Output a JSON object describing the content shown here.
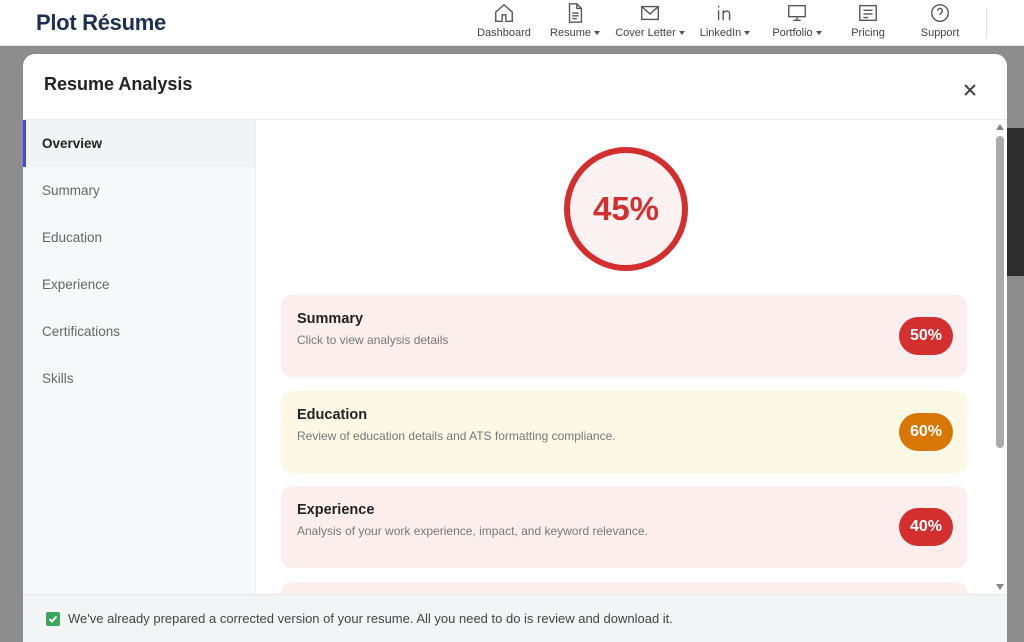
{
  "app": {
    "logo": "Plot Résume"
  },
  "nav": [
    {
      "label": "Dashboard",
      "icon": "home-icon",
      "dropdown": false
    },
    {
      "label": "Resume",
      "icon": "document-icon",
      "dropdown": true
    },
    {
      "label": "Cover Letter",
      "icon": "mail-icon",
      "dropdown": true
    },
    {
      "label": "LinkedIn",
      "icon": "linkedin-icon",
      "dropdown": true
    },
    {
      "label": "Portfolio",
      "icon": "monitor-icon",
      "dropdown": true
    },
    {
      "label": "Pricing",
      "icon": "pricing-icon",
      "dropdown": false
    },
    {
      "label": "Support",
      "icon": "help-icon",
      "dropdown": false
    }
  ],
  "modal": {
    "title": "Resume Analysis",
    "sidebar": [
      {
        "label": "Overview",
        "active": true
      },
      {
        "label": "Summary",
        "active": false
      },
      {
        "label": "Education",
        "active": false
      },
      {
        "label": "Experience",
        "active": false
      },
      {
        "label": "Certifications",
        "active": false
      },
      {
        "label": "Skills",
        "active": false
      }
    ],
    "overall_score": {
      "value": 45,
      "label": "45%",
      "color": "#d32f2f"
    },
    "cards": [
      {
        "title": "Summary",
        "description": "Click to view analysis details",
        "score": 50,
        "score_label": "50%",
        "bg_color": "#fdeeee",
        "badge_color": "#d32f2f"
      },
      {
        "title": "Education",
        "description": "Review of education details and ATS formatting compliance.",
        "score": 60,
        "score_label": "60%",
        "bg_color": "#fdf8e6",
        "badge_color": "#d97706"
      },
      {
        "title": "Experience",
        "description": "Analysis of your work experience, impact, and keyword relevance.",
        "score": 40,
        "score_label": "40%",
        "bg_color": "#fdeeee",
        "badge_color": "#d32f2f"
      }
    ],
    "footer": {
      "text": "We've already prepared a corrected version of your resume. All you need to do is review and download it.",
      "checked": true
    }
  }
}
